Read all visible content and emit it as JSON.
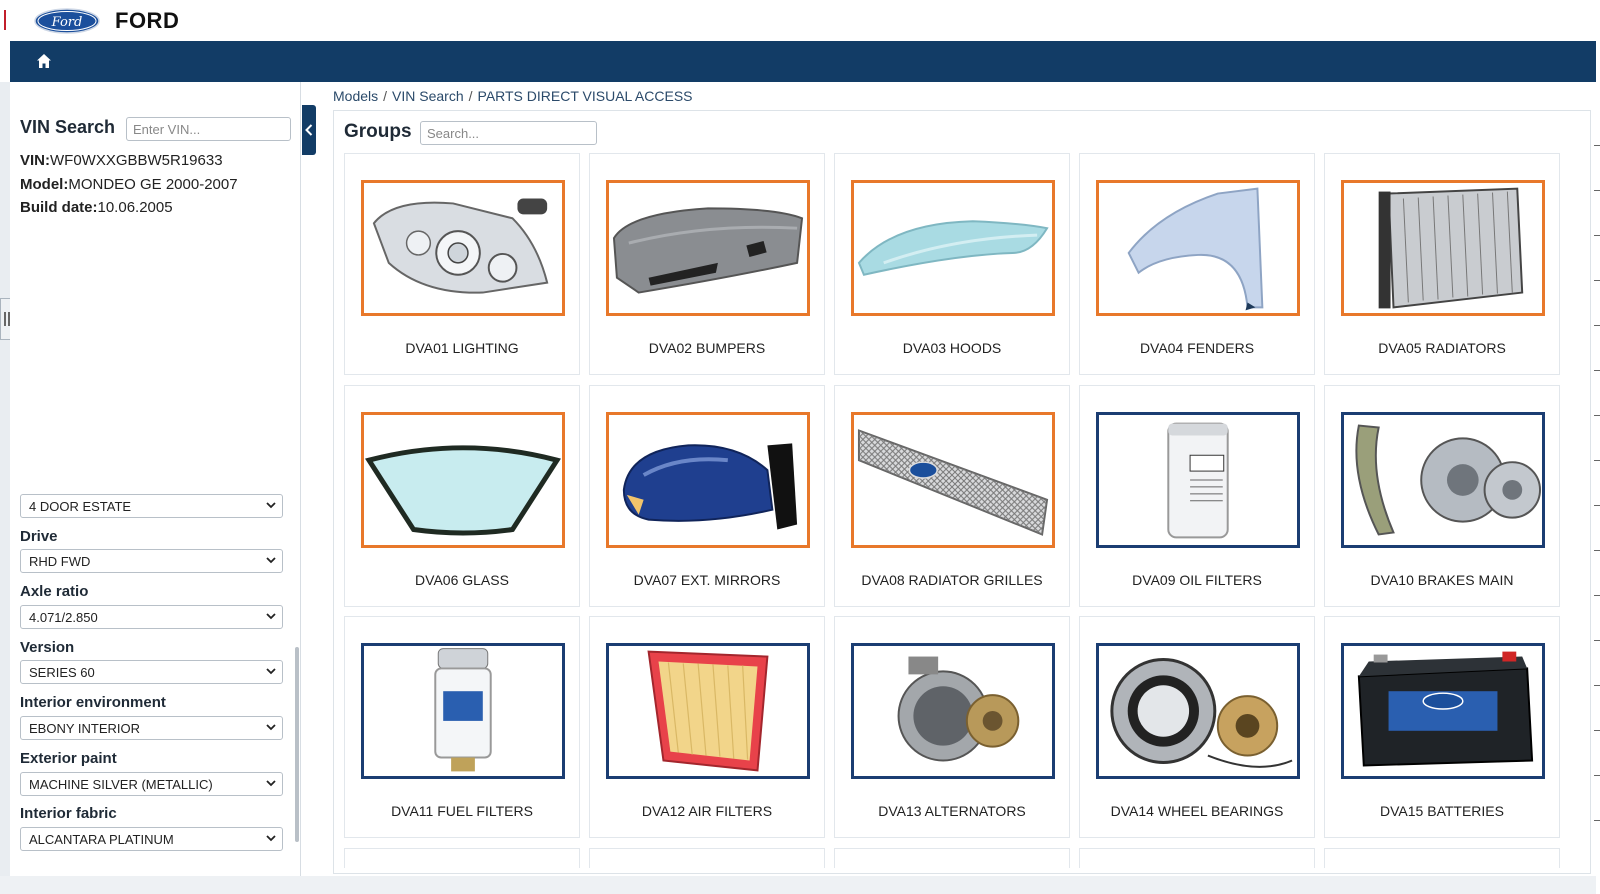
{
  "app": {
    "brand": "FORD",
    "logo_text": "Ford"
  },
  "nav": {
    "home_icon": "home-icon"
  },
  "sidebar": {
    "vin_search_title": "VIN Search",
    "vin_placeholder": "Enter VIN...",
    "vin_label": "VIN:",
    "vin_value": "WF0WXXGBBW5R19633",
    "model_label": "Model:",
    "model_value": "MONDEO GE 2000-2007",
    "build_label": "Build date:",
    "build_value": "10.06.2005",
    "body_select": "4 DOOR ESTATE",
    "fields": [
      {
        "label": "Drive",
        "value": "RHD FWD"
      },
      {
        "label": "Axle ratio",
        "value": "4.071/2.850"
      },
      {
        "label": "Version",
        "value": "SERIES 60"
      },
      {
        "label": "Interior environment",
        "value": "EBONY INTERIOR"
      },
      {
        "label": "Exterior paint",
        "value": "MACHINE SILVER (METALLIC)"
      },
      {
        "label": "Interior fabric",
        "value": "ALCANTARA PLATINUM"
      }
    ]
  },
  "breadcrumb": [
    "Models",
    "VIN Search",
    "PARTS DIRECT VISUAL ACCESS"
  ],
  "groups": {
    "title": "Groups",
    "search_placeholder": "Search...",
    "accent_orange": "#e8782a",
    "accent_blue": "#1b3d72",
    "items": [
      {
        "label": "DVA01 LIGHTING",
        "frame": "orange",
        "image": "headlight"
      },
      {
        "label": "DVA02 BUMPERS",
        "frame": "orange",
        "image": "bumper"
      },
      {
        "label": "DVA03 HOODS",
        "frame": "orange",
        "image": "hood"
      },
      {
        "label": "DVA04 FENDERS",
        "frame": "orange",
        "image": "fender"
      },
      {
        "label": "DVA05 RADIATORS",
        "frame": "orange",
        "image": "radiator"
      },
      {
        "label": "DVA06 GLASS",
        "frame": "orange",
        "image": "windshield"
      },
      {
        "label": "DVA07 EXT. MIRRORS",
        "frame": "orange",
        "image": "mirror"
      },
      {
        "label": "DVA08 RADIATOR GRILLES",
        "frame": "orange",
        "image": "grille"
      },
      {
        "label": "DVA09 OIL FILTERS",
        "frame": "blue",
        "image": "oil-filter"
      },
      {
        "label": "DVA10 BRAKES MAIN",
        "frame": "blue",
        "image": "brakes"
      },
      {
        "label": "DVA11 FUEL FILTERS",
        "frame": "blue",
        "image": "fuel-filter"
      },
      {
        "label": "DVA12 AIR FILTERS",
        "frame": "blue",
        "image": "air-filter"
      },
      {
        "label": "DVA13 ALTERNATORS",
        "frame": "blue",
        "image": "alternator"
      },
      {
        "label": "DVA14 WHEEL BEARINGS",
        "frame": "blue",
        "image": "wheel-bearing"
      },
      {
        "label": "DVA15 BATTERIES",
        "frame": "blue",
        "image": "battery"
      }
    ]
  }
}
